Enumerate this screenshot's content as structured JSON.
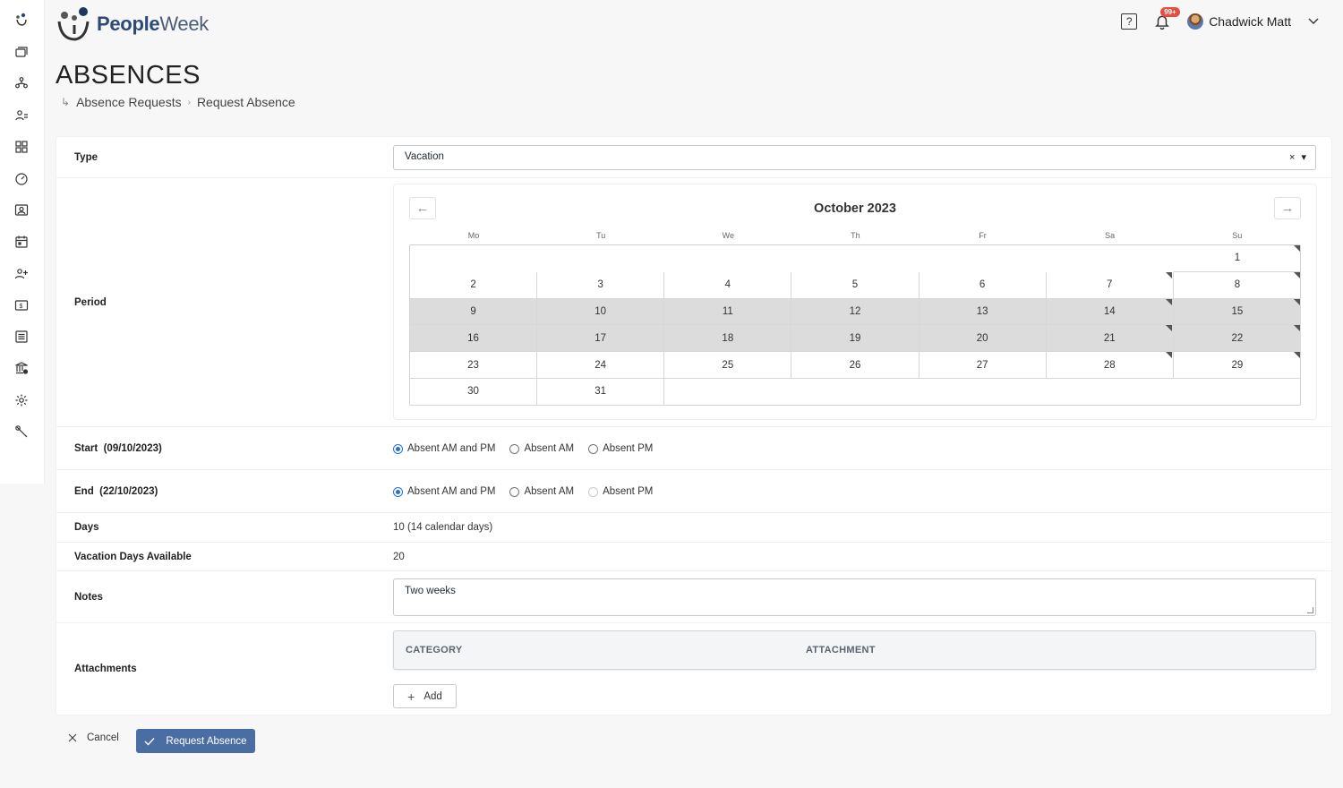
{
  "app": {
    "logo_text_bold": "People",
    "logo_text_light": "Week"
  },
  "header": {
    "notification_badge": "99+",
    "user_name": "Chadwick Matt",
    "help_glyph": "?"
  },
  "sidebar": {
    "icons": [
      "logo-icon",
      "cards-icon",
      "org-chart-icon",
      "team-icon",
      "dashboard-grid-icon",
      "speedometer-icon",
      "users-group-icon",
      "calendar-icon",
      "add-user-icon",
      "payroll-icon",
      "list-icon",
      "bank-icon",
      "settings-icon",
      "tools-icon"
    ]
  },
  "page": {
    "title": "ABSENCES",
    "breadcrumb": [
      "Absence Requests",
      "Request Absence"
    ]
  },
  "form": {
    "type": {
      "label": "Type",
      "value": "Vacation",
      "clear_glyph": "×"
    },
    "period": {
      "label": "Period",
      "month_title": "October 2023",
      "weekdays": [
        "Mo",
        "Tu",
        "We",
        "Th",
        "Fr",
        "Sa",
        "Su"
      ],
      "first_weekday_index": 6,
      "days_in_month": 31,
      "selected_range": [
        9,
        22
      ],
      "marked_days": [
        1,
        7,
        8,
        14,
        15,
        21,
        22,
        28,
        29
      ]
    },
    "start": {
      "label": "Start",
      "date": "(09/10/2023)",
      "options": [
        "Absent AM and PM",
        "Absent AM",
        "Absent PM"
      ],
      "selected": "Absent AM and PM"
    },
    "end": {
      "label": "End",
      "date": "(22/10/2023)",
      "options": [
        "Absent AM and PM",
        "Absent AM",
        "Absent PM"
      ],
      "selected": "Absent AM and PM"
    },
    "days": {
      "label": "Days",
      "value": "10 (14 calendar days)"
    },
    "vacation_available": {
      "label": "Vacation Days Available",
      "value": "20"
    },
    "notes": {
      "label": "Notes",
      "value": "Two weeks"
    },
    "attachments": {
      "label": "Attachments",
      "columns": [
        "CATEGORY",
        "ATTACHMENT"
      ],
      "add_label": "Add"
    }
  },
  "actions": {
    "cancel_label": "Cancel",
    "submit_label": "Request Absence"
  },
  "colors": {
    "brand": "#2c4a77",
    "primary_button": "#4a6ea3",
    "selected_range": "#dcdcdc",
    "radio_active": "#2a6fd6",
    "badge": "#e74c3c"
  }
}
